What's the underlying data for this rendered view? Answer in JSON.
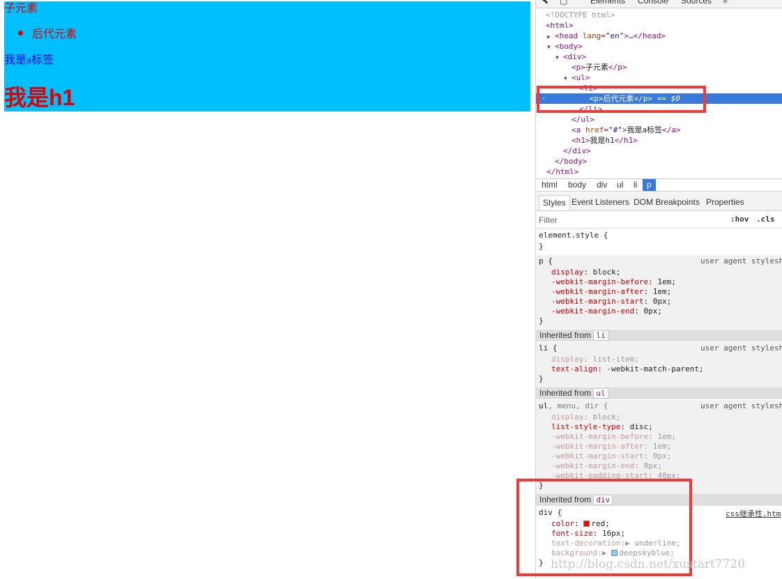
{
  "page": {
    "child_p": "子元素",
    "li_p": "后代元素",
    "link": "我是a标签",
    "h1": "我是h1"
  },
  "devtools": {
    "toolbar": [
      "Elements",
      "Console",
      "Sources",
      "»"
    ],
    "dom": {
      "doctype": "<!DOCTYPE html>",
      "html_open": "html",
      "head": "head",
      "head_attr": "lang",
      "head_val": "\"en\"",
      "head_tail": ">…</",
      "body": "body",
      "div": "div",
      "p": "p",
      "p_text": "子元素",
      "ul": "ul",
      "li": "li",
      "sel_text": "后代元素",
      "sel_suffix": " == $0",
      "a": "a",
      "a_attr": "href",
      "a_val": "\"#\"",
      "a_text": "我是a标签",
      "h1": "h1",
      "h1_text": "我是h1"
    },
    "breadcrumbs": [
      "html",
      "body",
      "div",
      "ul",
      "li",
      "p"
    ],
    "style_tabs": [
      "Styles",
      "Event Listeners",
      "DOM Breakpoints",
      "Properties"
    ],
    "filter": {
      "placeholder": "Filter",
      "hov": ":hov",
      "cls": ".cls"
    },
    "element_style": "element.style {",
    "close_brace": "}",
    "ua_source": "user agent stylesh",
    "rules": {
      "p": {
        "selector": "p {",
        "decls": [
          {
            "name": "display",
            "value": "block;"
          },
          {
            "name": "-webkit-margin-before",
            "value": "1em;"
          },
          {
            "name": "-webkit-margin-after",
            "value": "1em;"
          },
          {
            "name": "-webkit-margin-start",
            "value": "0px;"
          },
          {
            "name": "-webkit-margin-end",
            "value": "0px;"
          }
        ]
      },
      "li": {
        "inherited_label": "Inherited from",
        "inherited_tag": "li",
        "selector": "li {",
        "decls": [
          {
            "name": "display",
            "value": "list-item;"
          },
          {
            "name": "text-align",
            "value": "-webkit-match-parent;"
          }
        ]
      },
      "ul": {
        "inherited_label": "Inherited from",
        "inherited_tag": "ul",
        "selector_main": "ul",
        "selector_rest": ", menu, dir {",
        "decls": [
          {
            "name": "display",
            "value": "block;"
          },
          {
            "name": "list-style-type",
            "value": "disc;"
          },
          {
            "name": "-webkit-margin-before",
            "value": "1em;"
          },
          {
            "name": "-webkit-margin-after",
            "value": "1em;"
          },
          {
            "name": "-webkit-margin-start",
            "value": "0px;"
          },
          {
            "name": "-webkit-margin-end",
            "value": "0px;"
          },
          {
            "name": "-webkit-padding-start",
            "value": "40px;"
          }
        ]
      },
      "div": {
        "inherited_label": "Inherited from",
        "inherited_tag": "div",
        "selector": "div {",
        "source": "css继承性.htm",
        "decls": [
          {
            "name": "color",
            "value": "red;",
            "swatch": "#ff0000"
          },
          {
            "name": "font-size",
            "value": "16px;"
          },
          {
            "name": "text-decoration",
            "value": "underline;"
          },
          {
            "name": "background",
            "value": "deepskyblue;",
            "swatch": "#87cefa"
          }
        ]
      }
    }
  },
  "watermark": "http://blog.csdn.net/xustart7720",
  "colors": {
    "div_background": "#00bfff",
    "text_red": "#e00000",
    "selection": "#3879d9",
    "highlight_box": "#ef3a3a"
  }
}
